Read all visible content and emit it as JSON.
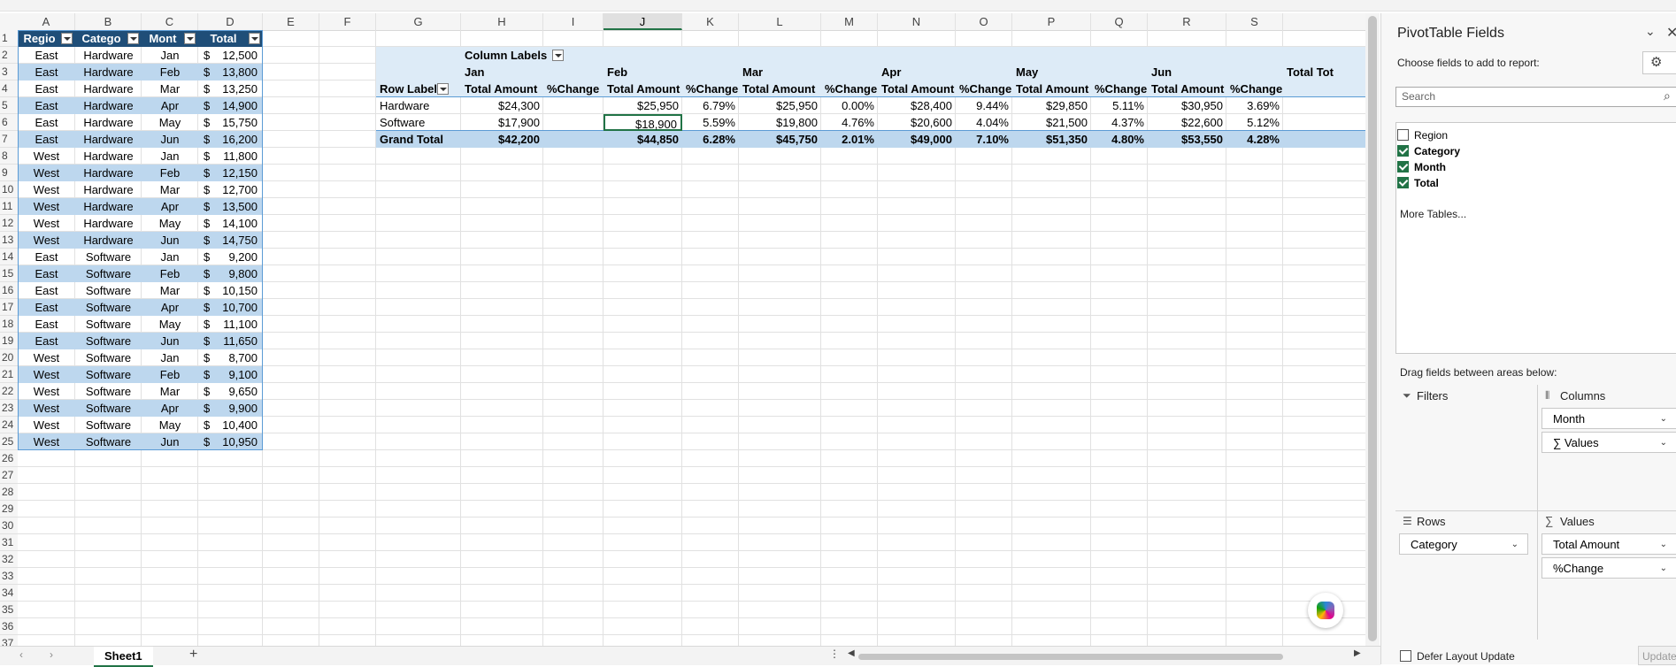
{
  "columns": [
    "A",
    "B",
    "C",
    "D",
    "E",
    "F",
    "G",
    "H",
    "I",
    "J",
    "K",
    "L",
    "M",
    "N",
    "O",
    "P",
    "Q",
    "R",
    "S"
  ],
  "selected_column": "J",
  "rows": [
    "1",
    "2",
    "3",
    "4",
    "5",
    "6",
    "7",
    "8",
    "9",
    "10",
    "11",
    "12",
    "13",
    "14",
    "15",
    "16",
    "17",
    "18",
    "19",
    "20",
    "21",
    "22",
    "23",
    "24",
    "25",
    "26",
    "27",
    "28",
    "29",
    "30",
    "31",
    "32",
    "33",
    "34",
    "35",
    "36",
    "37"
  ],
  "table": {
    "headers": [
      "Regio",
      "Catego",
      "Mont",
      "Total"
    ],
    "currency_symbol": "$",
    "rows": [
      [
        "East",
        "Hardware",
        "Jan",
        "12,500"
      ],
      [
        "East",
        "Hardware",
        "Feb",
        "13,800"
      ],
      [
        "East",
        "Hardware",
        "Mar",
        "13,250"
      ],
      [
        "East",
        "Hardware",
        "Apr",
        "14,900"
      ],
      [
        "East",
        "Hardware",
        "May",
        "15,750"
      ],
      [
        "East",
        "Hardware",
        "Jun",
        "16,200"
      ],
      [
        "West",
        "Hardware",
        "Jan",
        "11,800"
      ],
      [
        "West",
        "Hardware",
        "Feb",
        "12,150"
      ],
      [
        "West",
        "Hardware",
        "Mar",
        "12,700"
      ],
      [
        "West",
        "Hardware",
        "Apr",
        "13,500"
      ],
      [
        "West",
        "Hardware",
        "May",
        "14,100"
      ],
      [
        "West",
        "Hardware",
        "Jun",
        "14,750"
      ],
      [
        "East",
        "Software",
        "Jan",
        "9,200"
      ],
      [
        "East",
        "Software",
        "Feb",
        "9,800"
      ],
      [
        "East",
        "Software",
        "Mar",
        "10,150"
      ],
      [
        "East",
        "Software",
        "Apr",
        "10,700"
      ],
      [
        "East",
        "Software",
        "May",
        "11,100"
      ],
      [
        "East",
        "Software",
        "Jun",
        "11,650"
      ],
      [
        "West",
        "Software",
        "Jan",
        "8,700"
      ],
      [
        "West",
        "Software",
        "Feb",
        "9,100"
      ],
      [
        "West",
        "Software",
        "Mar",
        "9,650"
      ],
      [
        "West",
        "Software",
        "Apr",
        "9,900"
      ],
      [
        "West",
        "Software",
        "May",
        "10,400"
      ],
      [
        "West",
        "Software",
        "Jun",
        "10,950"
      ]
    ]
  },
  "pivot": {
    "column_labels": "Column Labels",
    "row_labels": "Row Labels",
    "months": [
      "Jan",
      "Feb",
      "Mar",
      "Apr",
      "May",
      "Jun"
    ],
    "total_amount_label": "Total Amount",
    "change_label": "%Change",
    "grand_total_col": "Total Tot",
    "rows": [
      {
        "label": "Hardware",
        "values": [
          "$24,300",
          "",
          "$25,950",
          "6.79%",
          "$25,950",
          "0.00%",
          "$28,400",
          "9.44%",
          "$29,850",
          "5.11%",
          "$30,950",
          "3.69%"
        ]
      },
      {
        "label": "Software",
        "values": [
          "$17,900",
          "",
          "$18,900",
          "5.59%",
          "$19,800",
          "4.76%",
          "$20,600",
          "4.04%",
          "$21,500",
          "4.37%",
          "$22,600",
          "5.12%"
        ]
      }
    ],
    "grand_total": {
      "label": "Grand Total",
      "values": [
        "$42,200",
        "",
        "$44,850",
        "6.28%",
        "$45,750",
        "2.01%",
        "$49,000",
        "7.10%",
        "$51,350",
        "4.80%",
        "$53,550",
        "4.28%"
      ]
    }
  },
  "sheet_tab": "Sheet1",
  "panel": {
    "title": "PivotTable Fields",
    "subtitle": "Choose fields to add to report:",
    "search_placeholder": "Search",
    "fields": [
      {
        "label": "Region",
        "checked": false
      },
      {
        "label": "Category",
        "checked": true
      },
      {
        "label": "Month",
        "checked": true
      },
      {
        "label": "Total",
        "checked": true
      }
    ],
    "more_tables": "More Tables...",
    "drag_label": "Drag fields between areas below:",
    "filters_title": "Filters",
    "columns_title": "Columns",
    "rows_title": "Rows",
    "values_title": "Values",
    "columns_items": [
      "Month",
      "∑ Values"
    ],
    "rows_items": [
      "Category"
    ],
    "values_items": [
      "Total Amount",
      "%Change"
    ],
    "defer_label": "Defer Layout Update",
    "update_button": "Update"
  }
}
